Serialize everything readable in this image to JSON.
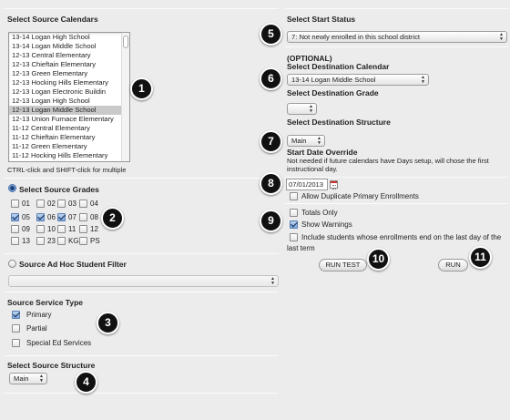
{
  "left": {
    "source_calendars": {
      "title": "Select Source Calendars",
      "items": [
        "13-14 Logan High School",
        "13-14 Logan Middle School",
        "12-13 Central Elementary",
        "12-13 Chieftain Elementary",
        "12-13 Green Elementary",
        "12-13 Hocking Hills Elementary",
        "12-13 Logan Electronic Buildin",
        "12-13 Logan High School",
        "12-13 Logan Middle School",
        "12-13 Union Furnace Elementary",
        "11-12 Central Elementary",
        "11-12 Chieftain Elementary",
        "11-12 Green Elementary",
        "11-12 Hocking Hills Elementary",
        "11-12 Logan Electronic Buildin"
      ],
      "selected_index": 8,
      "hint": "CTRL-click and SHIFT-click for multiple"
    },
    "source_grades": {
      "label": "Select Source Grades",
      "selected": true,
      "grades": [
        {
          "label": "01",
          "checked": false
        },
        {
          "label": "02",
          "checked": false
        },
        {
          "label": "03",
          "checked": false
        },
        {
          "label": "04",
          "checked": false
        },
        {
          "label": "05",
          "checked": true
        },
        {
          "label": "06",
          "checked": true
        },
        {
          "label": "07",
          "checked": true
        },
        {
          "label": "08",
          "checked": false
        },
        {
          "label": "09",
          "checked": false
        },
        {
          "label": "10",
          "checked": false
        },
        {
          "label": "11",
          "checked": false
        },
        {
          "label": "12",
          "checked": false
        },
        {
          "label": "13",
          "checked": false
        },
        {
          "label": "23",
          "checked": false
        },
        {
          "label": "KG",
          "checked": false
        },
        {
          "label": "PS",
          "checked": false
        }
      ]
    },
    "adhoc": {
      "label": "Source Ad Hoc Student Filter",
      "selected": false,
      "value": ""
    },
    "service_type": {
      "title": "Source Service Type",
      "options": [
        {
          "label": "Primary",
          "checked": true
        },
        {
          "label": "Partial",
          "checked": false
        },
        {
          "label": "Special Ed Services",
          "checked": false
        }
      ]
    },
    "structure": {
      "title": "Select Source Structure",
      "value": "Main"
    }
  },
  "right": {
    "start_status": {
      "title": "Select Start Status",
      "value": "7: Not newly enrolled in this school district"
    },
    "dest_calendar": {
      "optional": "(OPTIONAL)",
      "title": "Select Destination Calendar",
      "value": "13-14 Logan Middle School"
    },
    "dest_grade": {
      "title": "Select Destination Grade",
      "value": ""
    },
    "dest_structure": {
      "title": "Select Destination Structure",
      "value": "Main"
    },
    "start_date": {
      "title": "Start Date Override",
      "note_line1": "Not needed if future calendars have Days setup, will chose the first",
      "note_line2": "instructional day.",
      "value": "07/01/2013"
    },
    "allow_duplicate": {
      "label": "Allow Duplicate Primary Enrollments",
      "checked": false
    },
    "totals_only": {
      "label": "Totals Only",
      "checked": false
    },
    "show_warnings": {
      "label": "Show Warnings",
      "checked": true
    },
    "include_ended": {
      "label_line1": "Include students whose enrollments end on the last day of the",
      "label_line2": "last term",
      "checked": false
    },
    "run_test_label": "RUN TEST",
    "run_label": "RUN"
  },
  "callouts": [
    "1",
    "2",
    "3",
    "4",
    "5",
    "6",
    "7",
    "8",
    "9",
    "10",
    "11"
  ]
}
